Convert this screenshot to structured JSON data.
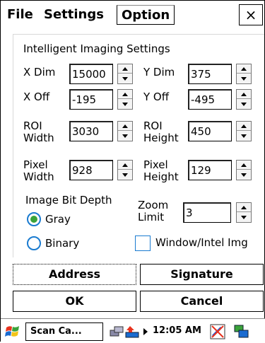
{
  "menu": {
    "file": "File",
    "settings": "Settings",
    "option": "Option",
    "close": "×"
  },
  "panel": {
    "title": "Intelligent Imaging Settings",
    "x_dim": {
      "label": "X Dim",
      "value": "15000"
    },
    "y_dim": {
      "label": "Y Dim",
      "value": "375"
    },
    "x_off": {
      "label": "X Off",
      "value": "-195"
    },
    "y_off": {
      "label": "Y Off",
      "value": "-495"
    },
    "roi_width": {
      "label_line1": "ROI",
      "label_line2": "Width",
      "value": "3030"
    },
    "roi_height": {
      "label_line1": "ROI",
      "label_line2": "Height",
      "value": "450"
    },
    "pixel_width": {
      "label_line1": "Pixel",
      "label_line2": "Width",
      "value": "928"
    },
    "pixel_height": {
      "label_line1": "Pixel",
      "label_line2": "Height",
      "value": "129"
    },
    "bit_depth": {
      "label": "Image Bit Depth",
      "options": [
        "Gray",
        "Binary"
      ],
      "selected": "Gray"
    },
    "zoom_limit": {
      "label_line1": "Zoom",
      "label_line2": "Limit",
      "value": "3"
    },
    "window_intel": {
      "label": "Window/Intel Img",
      "checked": false
    }
  },
  "buttons": {
    "address": "Address",
    "signature": "Signature",
    "ok": "OK",
    "cancel": "Cancel"
  },
  "taskbar": {
    "task": "Scan Ca...",
    "clock": "12:05 AM"
  }
}
